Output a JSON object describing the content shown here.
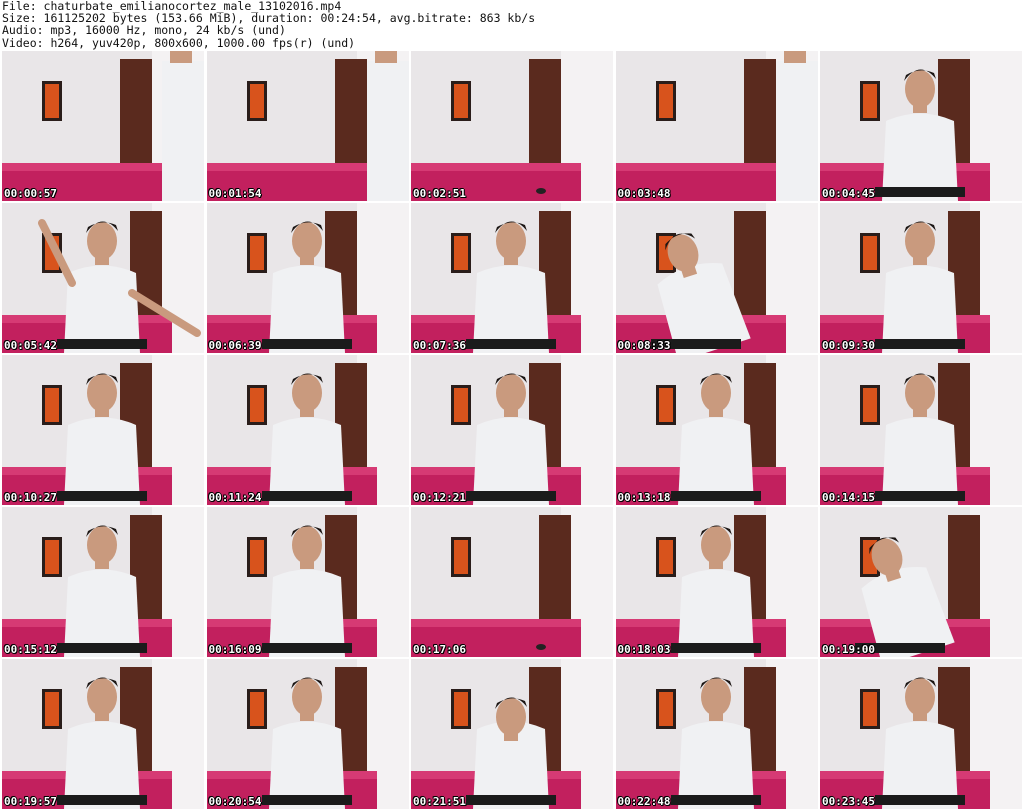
{
  "header": {
    "file": "File: chaturbate_emilianocortez_male_13102016.mp4",
    "size": "Size: 161125202 bytes (153.66 MiB), duration: 00:24:54, avg.bitrate: 863 kb/s",
    "audio": "Audio: mp3, 16000 Hz, mono, 24 kb/s (und)",
    "video": "Video: h264, yuv420p, 800x600, 1000.00 fps(r) (und)"
  },
  "thumbnails": [
    {
      "time": "00:00:57",
      "scene": "room-standing-partial"
    },
    {
      "time": "00:01:54",
      "scene": "room-standing-partial"
    },
    {
      "time": "00:02:51",
      "scene": "room-empty"
    },
    {
      "time": "00:03:48",
      "scene": "room-standing-partial"
    },
    {
      "time": "00:04:45",
      "scene": "person-seated"
    },
    {
      "time": "00:05:42",
      "scene": "person-gesturing"
    },
    {
      "time": "00:06:39",
      "scene": "person-seated"
    },
    {
      "time": "00:07:36",
      "scene": "person-seated"
    },
    {
      "time": "00:08:33",
      "scene": "person-leaning"
    },
    {
      "time": "00:09:30",
      "scene": "person-seated"
    },
    {
      "time": "00:10:27",
      "scene": "person-seated"
    },
    {
      "time": "00:11:24",
      "scene": "person-seated"
    },
    {
      "time": "00:12:21",
      "scene": "person-seated"
    },
    {
      "time": "00:13:18",
      "scene": "person-seated"
    },
    {
      "time": "00:14:15",
      "scene": "person-seated"
    },
    {
      "time": "00:15:12",
      "scene": "person-seated"
    },
    {
      "time": "00:16:09",
      "scene": "person-seated"
    },
    {
      "time": "00:17:06",
      "scene": "room-empty"
    },
    {
      "time": "00:18:03",
      "scene": "person-seated"
    },
    {
      "time": "00:19:00",
      "scene": "person-leaning"
    },
    {
      "time": "00:19:57",
      "scene": "person-seated"
    },
    {
      "time": "00:20:54",
      "scene": "person-seated"
    },
    {
      "time": "00:21:51",
      "scene": "person-head-down"
    },
    {
      "time": "00:22:48",
      "scene": "person-seated"
    },
    {
      "time": "00:23:45",
      "scene": "person-seated"
    }
  ],
  "colors": {
    "wall": "#e9e6e8",
    "door": "#5a2a1e",
    "bench": "#c2205e",
    "shirt": "#f0f1f3",
    "skin": "#c99a7e",
    "hair": "#1c1614",
    "painting_frame": "#2a1d1a",
    "painting_fill": "#d8531c"
  }
}
